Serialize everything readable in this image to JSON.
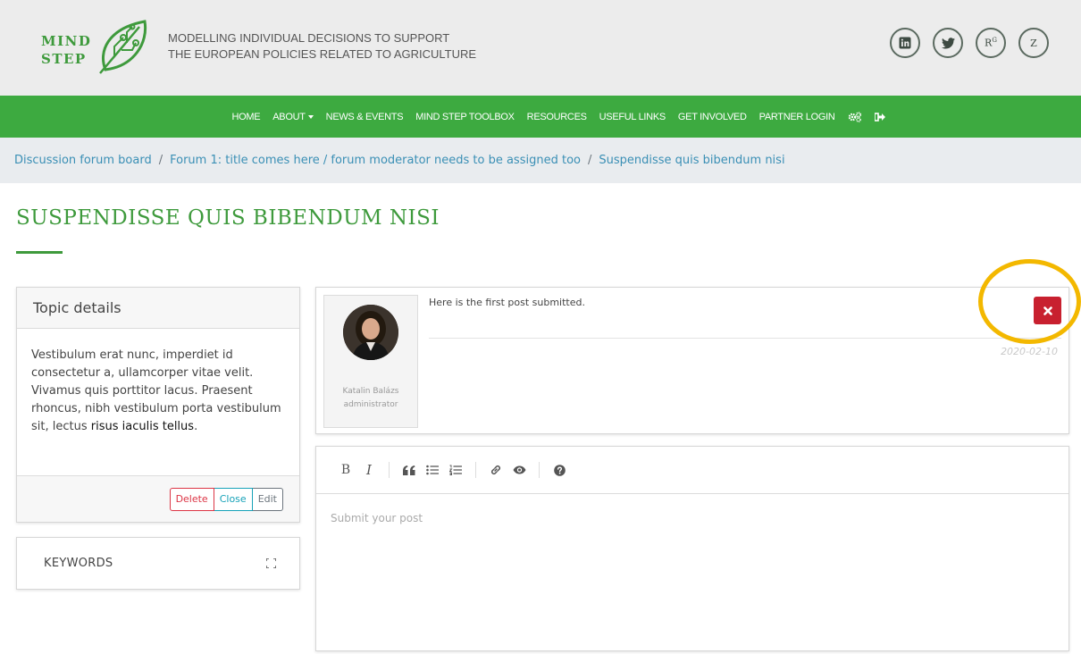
{
  "header": {
    "logo": {
      "line1": "MIND",
      "line2": "STEP"
    },
    "tagline": {
      "line1": "MODELLING INDIVIDUAL DECISIONS TO SUPPORT",
      "line2": "THE EUROPEAN POLICIES RELATED TO AGRICULTURE"
    },
    "social": [
      {
        "icon": "linkedin-icon",
        "label": "in"
      },
      {
        "icon": "twitter-icon",
        "label": ""
      },
      {
        "icon": "researchgate-icon",
        "label": "R",
        "sup": "G"
      },
      {
        "icon": "zenodo-icon",
        "label": "Z"
      }
    ]
  },
  "nav": {
    "items": [
      {
        "label": "HOME"
      },
      {
        "label": "ABOUT"
      },
      {
        "label": "NEWS & EVENTS"
      },
      {
        "label": "MIND STEP TOOLBOX"
      },
      {
        "label": "RESOURCES"
      },
      {
        "label": "USEFUL LINKS"
      },
      {
        "label": "GET INVOLVED"
      },
      {
        "label": "PARTNER LOGIN"
      }
    ],
    "icons": [
      "settings-cogs-icon",
      "sign-out-icon"
    ],
    "color": "#3daa40"
  },
  "breadcrumb": {
    "items": [
      "Discussion forum board",
      "Forum 1: title comes here / forum moderator needs to be assigned too",
      "Suspendisse quis bibendum nisi"
    ]
  },
  "page": {
    "title": "SUSPENDISSE QUIS BIBENDUM NISI",
    "accent_color": "#3e9a3c"
  },
  "topic": {
    "heading": "Topic details",
    "body": "Vestibulum erat nunc, imperdiet id consectetur a, ullamcorper vitae velit. Vivamus quis porttitor lacus. Praesent rhoncus, nibh vestibulum porta vestibulum sit, lectus ",
    "body_emphasis": "risus iaculis tellus",
    "body_end": ".",
    "buttons": {
      "delete": "Delete",
      "close": "Close",
      "edit": "Edit"
    }
  },
  "keywords": {
    "label": "KEYWORDS",
    "icon": "expand-icon"
  },
  "post": {
    "author_name": "Katalin Balázs",
    "author_role": "administrator",
    "text": "Here is the first post submitted.",
    "date": "2020-02-10",
    "delete_icon": "close-icon",
    "delete_color": "#c8202f",
    "highlight_color": "#f3b800"
  },
  "editor": {
    "placeholder": "Submit your post",
    "toolbar": [
      "bold-icon",
      "italic-icon",
      "quote-icon",
      "unordered-list-icon",
      "ordered-list-icon",
      "link-icon",
      "preview-icon",
      "help-icon"
    ],
    "bold_label": "B",
    "italic_label": "I"
  }
}
